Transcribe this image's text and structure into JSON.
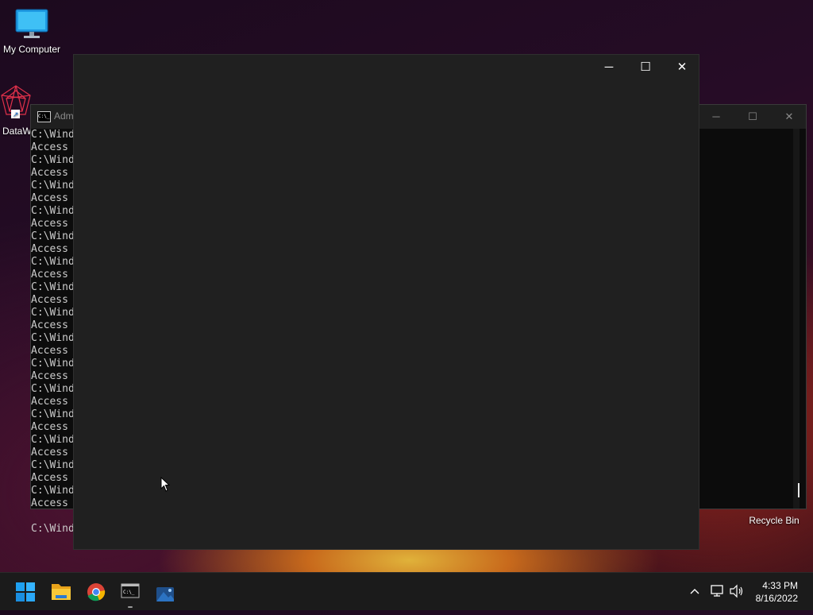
{
  "desktop": {
    "icons": [
      {
        "label": "My Computer",
        "icon": "monitor-icon"
      },
      {
        "label": "DataW",
        "icon": "datawrangler-icon"
      },
      {
        "label": "Recycle Bin",
        "icon": "recycle-bin-icon"
      }
    ]
  },
  "cmd_window": {
    "title": "Adm",
    "title_icon_text": "C:\\_",
    "lines": [
      "C:\\Wind",
      "Access",
      "C:\\Wind",
      "Access",
      "C:\\Wind",
      "Access",
      "C:\\Wind",
      "Access",
      "C:\\Wind",
      "Access",
      "C:\\Wind",
      "Access",
      "C:\\Wind",
      "Access",
      "C:\\Wind",
      "Access",
      "C:\\Wind",
      "Access",
      "C:\\Wind",
      "Access",
      "C:\\Wind",
      "Access",
      "C:\\Wind",
      "Access",
      "C:\\Wind",
      "Access",
      "C:\\Wind",
      "Access",
      "C:\\Wind",
      "Access",
      "",
      "C:\\Wind"
    ],
    "minimize_glyph": "─",
    "maximize_glyph": "☐",
    "close_glyph": "✕"
  },
  "front_window": {
    "minimize_glyph": "─",
    "maximize_glyph": "☐",
    "close_glyph": "✕"
  },
  "taskbar": {
    "apps": [
      "windows-start-icon",
      "file-explorer-icon",
      "chrome-icon",
      "terminal-icon",
      "photos-icon"
    ],
    "tray": {
      "chevron": "^",
      "network_icon": "network-icon",
      "volume_icon": "volume-icon"
    },
    "clock": {
      "time": "4:33 PM",
      "date": "8/16/2022"
    }
  }
}
